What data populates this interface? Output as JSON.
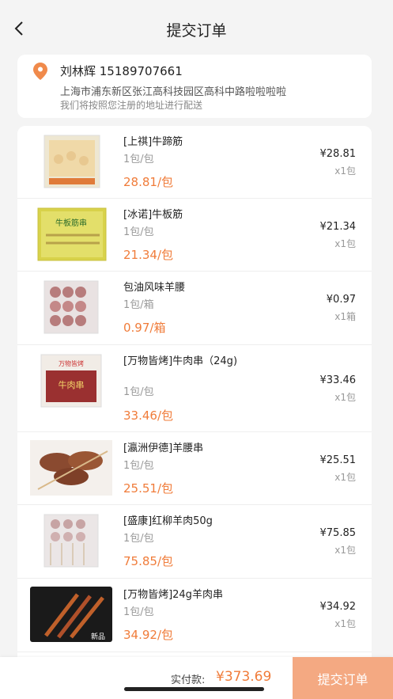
{
  "header": {
    "title": "提交订单"
  },
  "address": {
    "name_phone": "刘林辉  15189707661",
    "line": "上海市浦东新区张江高科技园区高科中路啦啦啦啦",
    "note": "我们将按照您注册的地址进行配送"
  },
  "items": [
    {
      "name": "[上祺]牛蹄筋",
      "unit": "1包/包",
      "unit_price": "28.81/包",
      "price": "¥28.81",
      "qty": "x1包"
    },
    {
      "name": "[冰诺]牛板筋",
      "unit": "1包/包",
      "unit_price": "21.34/包",
      "price": "¥21.34",
      "qty": "x1包"
    },
    {
      "name": "包油风味羊腰",
      "unit": "1包/箱",
      "unit_price": "0.97/箱",
      "price": "¥0.97",
      "qty": "x1箱"
    },
    {
      "name": "[万物皆烤]牛肉串（24g)",
      "unit": "1包/包",
      "unit_price": "33.46/包",
      "price": "¥33.46",
      "qty": "x1包"
    },
    {
      "name": "[瀛洲伊德]羊腰串",
      "unit": "1包/包",
      "unit_price": "25.51/包",
      "price": "¥25.51",
      "qty": "x1包"
    },
    {
      "name": "[盛康]红柳羊肉50g",
      "unit": "1包/包",
      "unit_price": "75.85/包",
      "price": "¥75.85",
      "qty": "x1包"
    },
    {
      "name": "[万物皆烤]24g羊肉串",
      "unit": "1包/包",
      "unit_price": "34.92/包",
      "price": "¥34.92",
      "qty": "x1包"
    }
  ],
  "thumb_labels": {
    "item1": "牛板筋串",
    "item4": "牛肉串",
    "item7": "新品"
  },
  "footer": {
    "total_label": "实付款:",
    "total_amount": "¥373.69",
    "submit_label": "提交订单"
  },
  "colors": {
    "accent": "#f07c3a",
    "submit_bg": "#f4a982",
    "background": "#f4f4f4"
  }
}
